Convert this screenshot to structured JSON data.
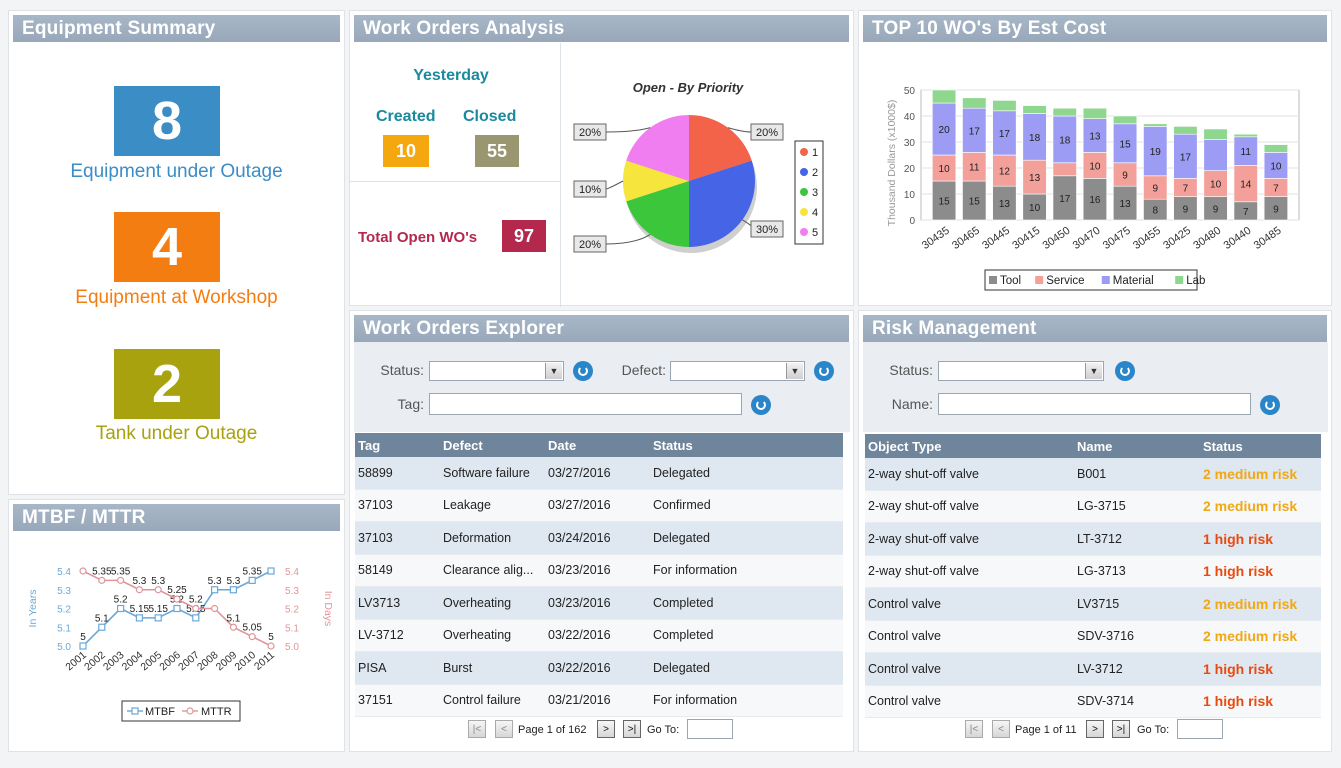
{
  "equipment": {
    "title": "Equipment Summary",
    "items": [
      {
        "value": "8",
        "label": "Equipment under Outage",
        "color": "#3b8dc6",
        "label_color": "#3b8dc6"
      },
      {
        "value": "4",
        "label": "Equipment at Workshop",
        "color": "#f47d11",
        "label_color": "#f47d11"
      },
      {
        "value": "2",
        "label": "Tank under Outage",
        "color": "#a9a20f",
        "label_color": "#a9a20f"
      }
    ]
  },
  "wo_analysis": {
    "title": "Work Orders Analysis",
    "yesterday_label": "Yesterday",
    "created_label": "Created",
    "closed_label": "Closed",
    "created_value": "10",
    "closed_value": "55",
    "total_open_label": "Total Open WO's",
    "total_open_value": "97"
  },
  "top10": {
    "title": "TOP 10 WO's By Est Cost"
  },
  "mtbf": {
    "title": "MTBF / MTTR"
  },
  "explorer": {
    "title": "Work Orders Explorer",
    "status_label": "Status:",
    "defect_label": "Defect:",
    "tag_label": "Tag:",
    "columns": [
      "Tag",
      "Defect",
      "Date",
      "Status"
    ],
    "rows": [
      [
        "58899",
        "Software failure",
        "03/27/2016",
        "Delegated"
      ],
      [
        "37103",
        "Leakage",
        "03/27/2016",
        "Confirmed"
      ],
      [
        "37103",
        "Deformation",
        "03/24/2016",
        "Delegated"
      ],
      [
        "58149",
        "Clearance alig...",
        "03/23/2016",
        "For information"
      ],
      [
        "LV3713",
        "Overheating",
        "03/23/2016",
        "Completed"
      ],
      [
        "LV-3712",
        "Overheating",
        "03/22/2016",
        "Completed"
      ],
      [
        "PISA",
        "Burst",
        "03/22/2016",
        "Delegated"
      ],
      [
        "37151",
        "Control failure",
        "03/21/2016",
        "For information"
      ]
    ],
    "pager": {
      "text": "Page 1 of 162",
      "goto": "Go To:"
    }
  },
  "risk": {
    "title": "Risk Management",
    "status_label": "Status:",
    "name_label": "Name:",
    "columns": [
      "Object Type",
      "Name",
      "Status"
    ],
    "rows": [
      [
        "2-way shut-off valve",
        "B001",
        "2 medium risk"
      ],
      [
        "2-way shut-off valve",
        "LG-3715",
        "2 medium risk"
      ],
      [
        "2-way shut-off valve",
        "LT-3712",
        "1 high risk"
      ],
      [
        "2-way shut-off valve",
        "LG-3713",
        "1 high risk"
      ],
      [
        "Control valve",
        "LV3715",
        "2 medium risk"
      ],
      [
        "Control valve",
        "SDV-3716",
        "2 medium risk"
      ],
      [
        "Control valve",
        "LV-3712",
        "1 high risk"
      ],
      [
        "Control valve",
        "SDV-3714",
        "1 high risk"
      ]
    ],
    "pager": {
      "text": "Page 1 of 11",
      "goto": "Go To:"
    }
  },
  "chart_data": [
    {
      "type": "pie",
      "title": "Open - By Priority",
      "categories": [
        "1",
        "2",
        "3",
        "4",
        "5"
      ],
      "values": [
        20,
        30,
        20,
        10,
        20
      ],
      "labels": [
        "20%",
        "30%",
        "20%",
        "10%",
        "20%"
      ],
      "colors": [
        "#f2634a",
        "#4664e6",
        "#3cc63c",
        "#f5e53c",
        "#f07ef0"
      ],
      "legend": "right"
    },
    {
      "type": "bar",
      "stacked": true,
      "ylabel": "Thousand Dollars (x1000$)",
      "ylim": [
        0,
        50
      ],
      "yticks": [
        0,
        10,
        20,
        30,
        40,
        50
      ],
      "categories": [
        "30435",
        "30465",
        "30445",
        "30415",
        "30450",
        "30470",
        "30475",
        "30455",
        "30425",
        "30480",
        "30440",
        "30485"
      ],
      "series": [
        {
          "name": "Tool",
          "color": "#8c8c8c",
          "values": [
            15,
            15,
            13,
            10,
            17,
            16,
            13,
            8,
            9,
            9,
            7,
            9
          ],
          "labels": [
            "15",
            "15",
            "13",
            "10",
            "17",
            "16",
            "13",
            "8",
            "9",
            "9",
            "7",
            "9"
          ]
        },
        {
          "name": "Service",
          "color": "#f4a09a",
          "values": [
            10,
            11,
            12,
            13,
            5,
            10,
            9,
            9,
            7,
            10,
            14,
            7
          ],
          "labels": [
            "10",
            "11",
            "12",
            "13",
            "",
            "10",
            "9",
            "9",
            "7",
            "10",
            "14",
            "7"
          ]
        },
        {
          "name": "Material",
          "color": "#9c9cf4",
          "values": [
            20,
            17,
            17,
            18,
            18,
            13,
            15,
            19,
            17,
            12,
            11,
            10
          ],
          "labels": [
            "20",
            "17",
            "17",
            "18",
            "18",
            "13",
            "15",
            "19",
            "17",
            "",
            "11",
            "10"
          ]
        },
        {
          "name": "Lab",
          "color": "#8fd68f",
          "values": [
            5,
            4,
            4,
            3,
            3,
            4,
            3,
            1,
            3,
            4,
            1,
            3
          ],
          "labels": [
            "",
            "",
            "",
            "",
            "",
            "",
            "",
            "",
            "",
            "",
            "",
            ""
          ]
        }
      ],
      "legend": "bottom",
      "grid": true
    },
    {
      "type": "line",
      "categories": [
        "2001",
        "2002",
        "2003",
        "2004",
        "2005",
        "2006",
        "2007",
        "2008",
        "2009",
        "2010",
        "2011"
      ],
      "ylabel": "In Years",
      "y2label": "In Days",
      "ylim": [
        5.0,
        5.4
      ],
      "y2lim": [
        5.0,
        5.4
      ],
      "yticks": [
        "5.0",
        "5.1",
        "5.2",
        "5.3",
        "5.4"
      ],
      "series": [
        {
          "name": "MTBF",
          "color": "#6aa8d8",
          "axis": "left",
          "values": [
            5.0,
            5.1,
            5.2,
            5.15,
            5.15,
            5.2,
            5.15,
            5.3,
            5.3,
            5.35,
            5.4
          ],
          "labels": [
            "5",
            "5.1",
            "5.2",
            "5.15",
            "5.15",
            "5.2",
            "5.15",
            "5.3",
            "5.3",
            "5.35",
            ""
          ]
        },
        {
          "name": "MTTR",
          "color": "#e0959a",
          "axis": "right",
          "values": [
            5.4,
            5.35,
            5.35,
            5.3,
            5.3,
            5.25,
            5.2,
            5.2,
            5.1,
            5.05,
            5.0
          ],
          "labels": [
            "",
            "5.35",
            "5.35",
            "5.3",
            "5.3",
            "5.25",
            "5.2",
            "",
            "5.1",
            "5.05",
            "5"
          ]
        }
      ],
      "legend": "bottom"
    }
  ]
}
